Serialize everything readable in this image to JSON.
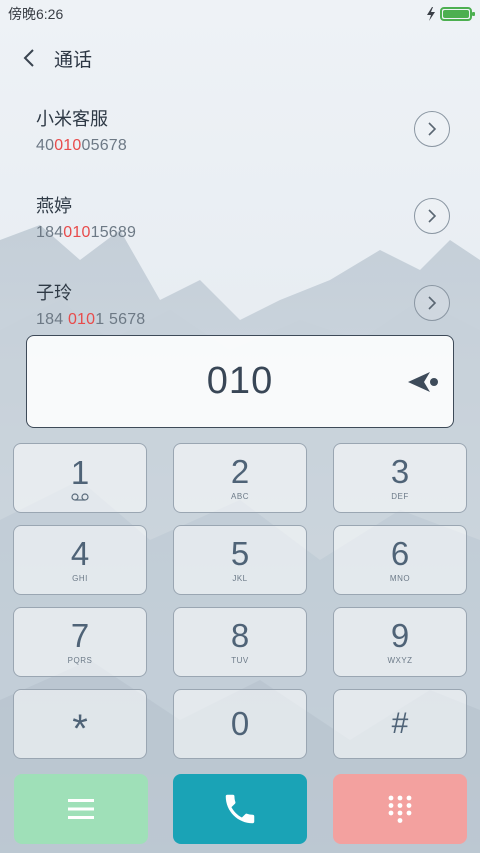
{
  "status": {
    "time": "傍晚6:26",
    "battery_level": 1.0
  },
  "header": {
    "title": "通话"
  },
  "contacts": [
    {
      "name": "小米客服",
      "number_pre": "40",
      "number_match": "010",
      "number_post": "05678"
    },
    {
      "name": "燕婷",
      "number_pre": "184",
      "number_match": "010",
      "number_post": "15689"
    },
    {
      "name": "子玲",
      "number_pre": "184 ",
      "number_match": "010",
      "number_post": "1 5678"
    }
  ],
  "dialer": {
    "number": "010"
  },
  "keypad": [
    {
      "digit": "1",
      "letters": ""
    },
    {
      "digit": "2",
      "letters": "ABC"
    },
    {
      "digit": "3",
      "letters": "DEF"
    },
    {
      "digit": "4",
      "letters": "GHI"
    },
    {
      "digit": "5",
      "letters": "JKL"
    },
    {
      "digit": "6",
      "letters": "MNO"
    },
    {
      "digit": "7",
      "letters": "PQRS"
    },
    {
      "digit": "8",
      "letters": "TUV"
    },
    {
      "digit": "9",
      "letters": "WXYZ"
    },
    {
      "digit": "*",
      "letters": ""
    },
    {
      "digit": "0",
      "letters": ""
    },
    {
      "digit": "#",
      "letters": ""
    }
  ],
  "icons": {
    "back": "chevron-left-icon",
    "detail": "chevron-right-icon",
    "backspace": "backspace-icon",
    "voicemail": "voicemail-icon",
    "menu": "menu-icon",
    "call": "phone-icon",
    "dialpad": "dialpad-icon",
    "charging": "lightning-icon",
    "battery": "battery-icon"
  },
  "colors": {
    "highlight": "#e84b4b",
    "menu_button": "#9fe0b8",
    "call_button": "#1aa3b6",
    "dialpad_button": "#f3a19f",
    "battery": "#4caf50"
  }
}
